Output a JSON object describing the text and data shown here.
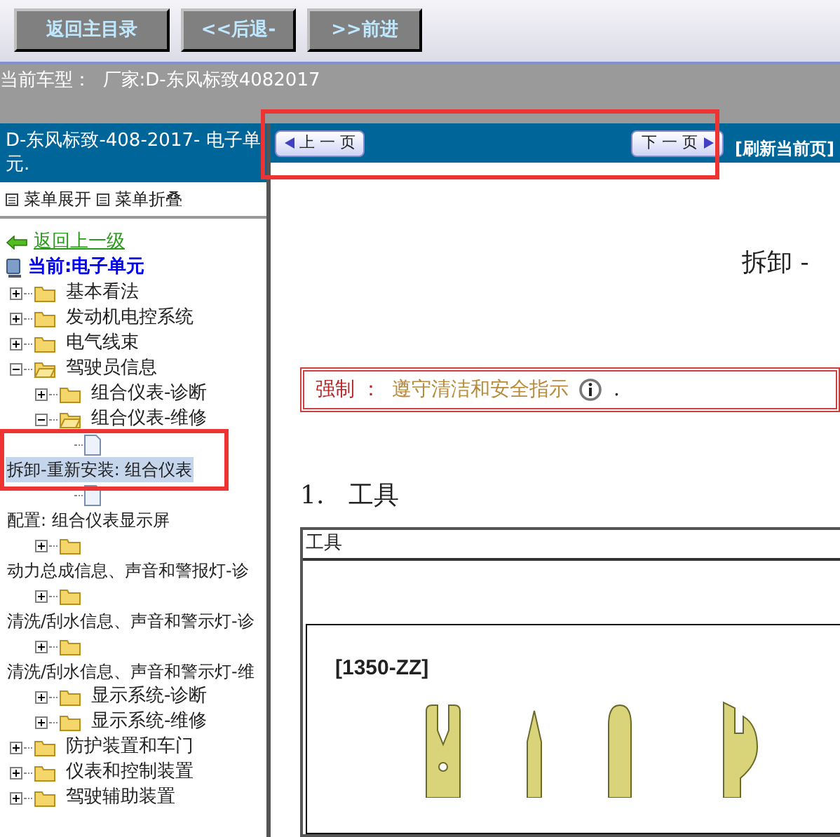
{
  "toolbar": {
    "buttons": [
      "返回主目录",
      "<<后退-",
      ">>前进"
    ]
  },
  "vehicle_bar": {
    "text": "当前车型：  厂家:D-东风标致4082017"
  },
  "sidebar": {
    "title": "D-东风标致-408-2017- 电子单元.",
    "menu_actions": [
      "菜单展开",
      "菜单折叠"
    ],
    "back_link": "返回上一级",
    "current": "当前:电子单元",
    "tree": [
      {
        "label": "基本看法",
        "kind": "folder",
        "expanded": false,
        "selected": false
      },
      {
        "label": "发动机电控系统",
        "kind": "folder",
        "expanded": false,
        "selected": false
      },
      {
        "label": "电气线束",
        "kind": "folder",
        "expanded": false,
        "selected": false
      },
      {
        "label": "驾驶员信息",
        "kind": "folder",
        "expanded": true,
        "selected": false,
        "children": [
          {
            "label": "组合仪表-诊断",
            "kind": "folder",
            "expanded": false,
            "selected": false
          },
          {
            "label": "组合仪表-维修",
            "kind": "folder",
            "expanded": true,
            "selected": false,
            "children": [
              {
                "label": "拆卸-重新安装: 组合仪表",
                "kind": "page",
                "selected": true
              },
              {
                "label": "配置: 组合仪表显示屏",
                "kind": "page",
                "selected": false
              }
            ]
          },
          {
            "label": "动力总成信息、声音和警报灯-诊",
            "kind": "wrapfolder",
            "expanded": false,
            "selected": false
          },
          {
            "label": "清洗/刮水信息、声音和警示灯-诊",
            "kind": "wrapfolder",
            "expanded": false,
            "selected": false
          },
          {
            "label": "清洗/刮水信息、声音和警示灯-维",
            "kind": "wrapfolder",
            "expanded": false,
            "selected": false
          },
          {
            "label": "显示系统-诊断",
            "kind": "folder",
            "expanded": false,
            "selected": false
          },
          {
            "label": "显示系统-维修",
            "kind": "folder",
            "expanded": false,
            "selected": false
          }
        ]
      },
      {
        "label": "防护装置和车门",
        "kind": "folder",
        "expanded": false,
        "selected": false
      },
      {
        "label": "仪表和控制装置",
        "kind": "folder",
        "expanded": false,
        "selected": false
      },
      {
        "label": "驾驶辅助装置",
        "kind": "folder",
        "expanded": false,
        "selected": false
      }
    ]
  },
  "content": {
    "prev_button": "上 一 页",
    "next_button": "下 一 页",
    "refresh_link": "[刷新当前页]",
    "title": "拆卸 -",
    "warning": {
      "label": "强制 ：",
      "text": "遵守清洁和安全指示",
      "suffix": "."
    },
    "section_heading": "1.   工具",
    "tool_table": {
      "header": "工具",
      "part_code": "[1350-ZZ]"
    }
  }
}
